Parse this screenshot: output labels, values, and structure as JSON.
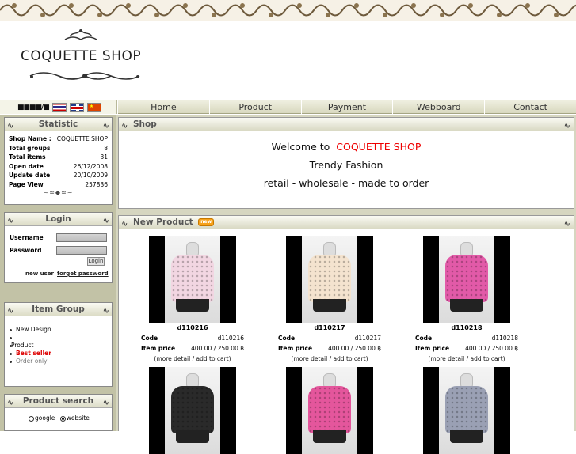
{
  "header": {
    "shop_name": "COQUETTE SHOP",
    "lang_text": "■■■■/■"
  },
  "nav": {
    "items": [
      "Home",
      "Product",
      "Payment",
      "Webboard",
      "Contact"
    ]
  },
  "statistic": {
    "title": "Statistic",
    "rows": [
      {
        "label": "Shop Name :",
        "value": "COQUETTE SHOP"
      },
      {
        "label": "Total groups",
        "value": "8"
      },
      {
        "label": "Total items",
        "value": "31"
      },
      {
        "label": "Open date",
        "value": "26/12/2008"
      },
      {
        "label": "Update date",
        "value": "20/10/2009"
      },
      {
        "label": "Page View",
        "value": "257836"
      }
    ]
  },
  "login": {
    "title": "Login",
    "username_label": "Username",
    "password_label": "Password",
    "button": "Login",
    "new_user": "new user",
    "forget": "forget password"
  },
  "item_group": {
    "title": "Item Group",
    "items": [
      "New Design",
      "",
      "Product",
      "Best seller",
      "Order only"
    ]
  },
  "search": {
    "title": "Product search",
    "opt1": "google",
    "opt2": "website"
  },
  "shop_panel": {
    "title": "Shop",
    "welcome": "Welcome to",
    "shop_name": "COQUETTE SHOP",
    "line2": "Trendy  Fashion",
    "line3": "retail - wholesale - made to order"
  },
  "new_product": {
    "title": "New Product",
    "badge": "new",
    "code_label": "Code",
    "price_label": "Item price",
    "detail": "(more detail / add to cart)",
    "items": [
      {
        "name": "d110216",
        "code": "d110216",
        "price": "400.00 / 250.00 ฿",
        "color": "#f2d6e2"
      },
      {
        "name": "d110217",
        "code": "d110217",
        "price": "400.00 / 250.00 ฿",
        "color": "#f4e3cf"
      },
      {
        "name": "d110218",
        "code": "d110218",
        "price": "400.00 / 250.00 ฿",
        "color": "#e25aa8"
      },
      {
        "name": "",
        "code": "",
        "price": "",
        "color": "#2a2a2a"
      },
      {
        "name": "",
        "code": "",
        "price": "",
        "color": "#e4569c"
      },
      {
        "name": "",
        "code": "",
        "price": "",
        "color": "#9aa0b4"
      }
    ]
  },
  "colors": {
    "accent_red": "#ee0000",
    "sidebar_bg": "#c2c2a6"
  }
}
